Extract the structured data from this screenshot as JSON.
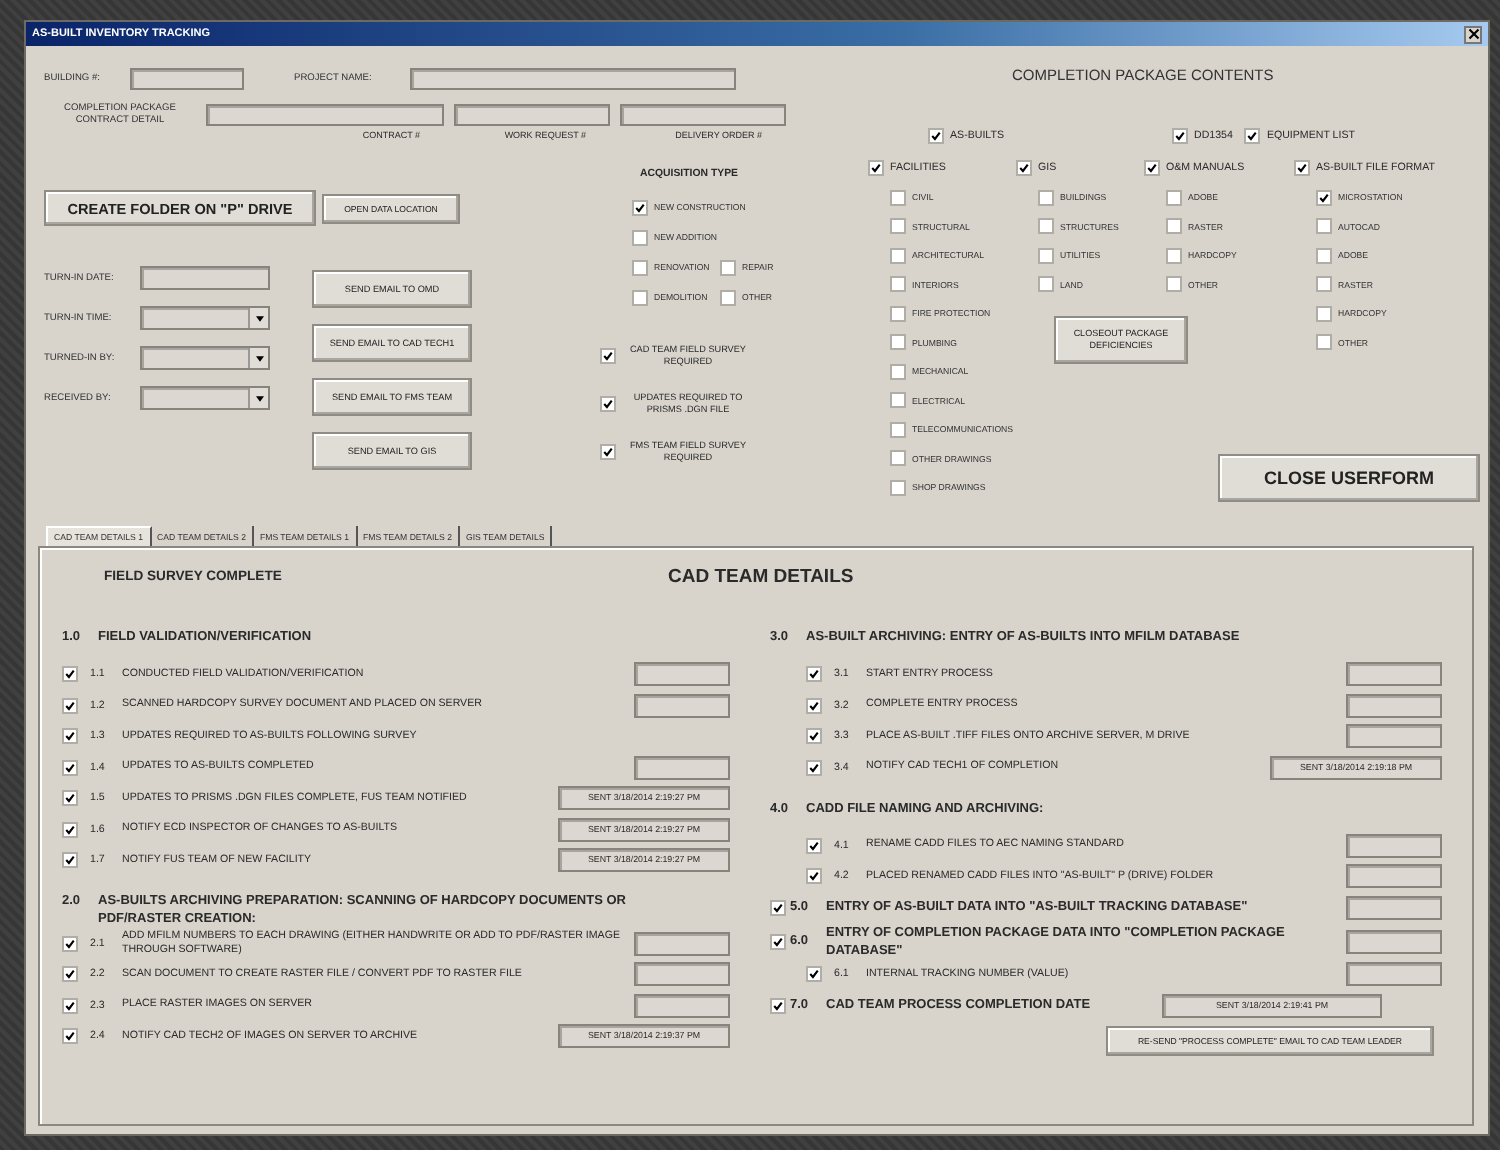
{
  "window": {
    "title": "AS-BUILT INVENTORY TRACKING"
  },
  "header": {
    "building_label": "BUILDING #:",
    "project_label": "PROJECT NAME:",
    "contract_detail_label": "COMPLETION PACKAGE CONTRACT DETAIL",
    "contract_fields": [
      "CONTRACT #",
      "WORK REQUEST #",
      "DELIVERY ORDER #"
    ]
  },
  "folder_buttons": [
    "CREATE FOLDER ON \"P\" DRIVE",
    "OPEN DATA LOCATION"
  ],
  "turn_in": [
    {
      "label": "TURN-IN DATE:",
      "kind": "text"
    },
    {
      "label": "TURN-IN TIME:",
      "kind": "dropdown"
    },
    {
      "label": "TURNED-IN BY:",
      "kind": "dropdown"
    },
    {
      "label": "RECEIVED BY:",
      "kind": "dropdown"
    }
  ],
  "email_buttons": [
    "SEND EMAIL TO OMD",
    "SEND EMAIL TO CAD TECH1",
    "SEND EMAIL TO FMS TEAM",
    "SEND EMAIL TO GIS"
  ],
  "acquisition": {
    "title": "ACQUISITION TYPE",
    "options": [
      {
        "label": "NEW CONSTRUCTION",
        "checked": true
      },
      {
        "label": "NEW ADDITION",
        "checked": false
      },
      {
        "label": "RENOVATION",
        "checked": false
      },
      {
        "label": "REPAIR",
        "checked": false
      },
      {
        "label": "DEMOLITION",
        "checked": false
      },
      {
        "label": "OTHER",
        "checked": false
      }
    ]
  },
  "flags": [
    {
      "label": "CAD TEAM FIELD SURVEY REQUIRED",
      "checked": true
    },
    {
      "label": "UPDATES REQUIRED TO PRISMS .DGN FILE",
      "checked": true
    },
    {
      "label": "FMS TEAM FIELD SURVEY REQUIRED",
      "checked": true
    }
  ],
  "contents": {
    "title": "COMPLETION PACKAGE CONTENTS",
    "top_options": [
      {
        "label": "AS-BUILTS",
        "checked": true
      },
      {
        "label": "DD1354",
        "checked": true
      },
      {
        "label": "EQUIPMENT LIST",
        "checked": true
      }
    ],
    "groups": [
      {
        "label": "FACILITIES",
        "checked": true,
        "items": [
          {
            "label": "CIVIL",
            "checked": false
          },
          {
            "label": "STRUCTURAL",
            "checked": false
          },
          {
            "label": "ARCHITECTURAL",
            "checked": false
          },
          {
            "label": "INTERIORS",
            "checked": false
          },
          {
            "label": "FIRE PROTECTION",
            "checked": false
          },
          {
            "label": "PLUMBING",
            "checked": false
          },
          {
            "label": "MECHANICAL",
            "checked": false
          },
          {
            "label": "ELECTRICAL",
            "checked": false
          },
          {
            "label": "TELECOMMUNICATIONS",
            "checked": false
          },
          {
            "label": "OTHER DRAWINGS",
            "checked": false
          },
          {
            "label": "SHOP DRAWINGS",
            "checked": false
          }
        ]
      },
      {
        "label": "GIS",
        "checked": true,
        "items": [
          {
            "label": "BUILDINGS",
            "checked": false
          },
          {
            "label": "STRUCTURES",
            "checked": false
          },
          {
            "label": "UTILITIES",
            "checked": false
          },
          {
            "label": "LAND",
            "checked": false
          }
        ]
      },
      {
        "label": "O&M MANUALS",
        "checked": true,
        "items": [
          {
            "label": "ADOBE",
            "checked": false
          },
          {
            "label": "RASTER",
            "checked": false
          },
          {
            "label": "HARDCOPY",
            "checked": false
          },
          {
            "label": "OTHER",
            "checked": false
          }
        ]
      },
      {
        "label": "AS-BUILT FILE FORMAT",
        "checked": true,
        "items": [
          {
            "label": "MICROSTATION",
            "checked": true
          },
          {
            "label": "AUTOCAD",
            "checked": false
          },
          {
            "label": "ADOBE",
            "checked": false
          },
          {
            "label": "RASTER",
            "checked": false
          },
          {
            "label": "HARDCOPY",
            "checked": false
          },
          {
            "label": "OTHER",
            "checked": false
          }
        ]
      }
    ],
    "closeout_button": "CLOSEOUT PACKAGE DEFICIENCIES",
    "close_button": "CLOSE USERFORM"
  },
  "tabs": [
    {
      "label": "CAD TEAM DETAILS 1",
      "selected": true
    },
    {
      "label": "CAD TEAM DETAILS 2",
      "selected": false
    },
    {
      "label": "FMS TEAM DETAILS 1",
      "selected": false
    },
    {
      "label": "FMS TEAM DETAILS 2",
      "selected": false
    },
    {
      "label": "GIS TEAM DETAILS",
      "selected": false
    }
  ],
  "details": {
    "left_title": "FIELD SURVEY COMPLETE",
    "title": "CAD TEAM DETAILS",
    "columns": [
      [
        {
          "kind": "section",
          "number": "1.0",
          "label": "FIELD VALIDATION/VERIFICATION"
        },
        {
          "kind": "item",
          "number": "1.1",
          "label": "CONDUCTED FIELD VALIDATION/VERIFICATION",
          "checked": true,
          "field": true
        },
        {
          "kind": "item",
          "number": "1.2",
          "label": "SCANNED HARDCOPY SURVEY DOCUMENT AND PLACED ON SERVER",
          "checked": true,
          "field": true
        },
        {
          "kind": "item",
          "number": "1.3",
          "label": "UPDATES REQUIRED TO AS-BUILTS FOLLOWING SURVEY",
          "checked": true,
          "field": false
        },
        {
          "kind": "item",
          "number": "1.4",
          "label": "UPDATES TO AS-BUILTS COMPLETED",
          "checked": true,
          "field": true
        },
        {
          "kind": "item",
          "number": "1.5",
          "label": "UPDATES TO PRISMS .DGN FILES COMPLETE, FUS TEAM NOTIFIED",
          "checked": true,
          "field": true,
          "value": "SENT 3/18/2014 2:19:27 PM"
        },
        {
          "kind": "item",
          "number": "1.6",
          "label": "NOTIFY ECD INSPECTOR OF CHANGES TO AS-BUILTS",
          "checked": true,
          "field": true,
          "value": "SENT 3/18/2014 2:19:27 PM"
        },
        {
          "kind": "item",
          "number": "1.7",
          "label": "NOTIFY FUS TEAM OF NEW FACILITY",
          "checked": true,
          "field": true,
          "value": "SENT 3/18/2014 2:19:27 PM"
        },
        {
          "kind": "section",
          "number": "2.0",
          "label": "AS-BUILTS ARCHIVING PREPARATION:  SCANNING OF HARDCOPY DOCUMENTS OR PDF/RASTER CREATION:"
        },
        {
          "kind": "item",
          "number": "2.1",
          "label": "ADD MFILM NUMBERS TO EACH DRAWING (EITHER HANDWRITE OR ADD TO PDF/RASTER IMAGE THROUGH SOFTWARE)",
          "checked": true,
          "field": true
        },
        {
          "kind": "item",
          "number": "2.2",
          "label": "SCAN DOCUMENT TO CREATE RASTER FILE / CONVERT PDF TO RASTER FILE",
          "checked": true,
          "field": true
        },
        {
          "kind": "item",
          "number": "2.3",
          "label": "PLACE RASTER IMAGES ON SERVER",
          "checked": true,
          "field": true
        },
        {
          "kind": "item",
          "number": "2.4",
          "label": "NOTIFY CAD TECH2 OF IMAGES ON SERVER TO ARCHIVE",
          "checked": true,
          "field": true,
          "value": "SENT 3/18/2014 2:19:37 PM"
        }
      ],
      [
        {
          "kind": "section",
          "number": "3.0",
          "label": "AS-BUILT ARCHIVING:  ENTRY OF AS-BUILTS INTO MFILM DATABASE"
        },
        {
          "kind": "item",
          "number": "3.1",
          "label": "START ENTRY PROCESS",
          "checked": true,
          "field": true
        },
        {
          "kind": "item",
          "number": "3.2",
          "label": "COMPLETE ENTRY PROCESS",
          "checked": true,
          "field": true
        },
        {
          "kind": "item",
          "number": "3.3",
          "label": "PLACE AS-BUILT .TIFF FILES ONTO ARCHIVE SERVER, M DRIVE",
          "checked": true,
          "field": true
        },
        {
          "kind": "item",
          "number": "3.4",
          "label": "NOTIFY CAD TECH1 OF COMPLETION",
          "checked": true,
          "field": true,
          "value": "SENT 3/18/2014 2:19:18 PM"
        },
        {
          "kind": "section",
          "number": "4.0",
          "label": "CADD FILE NAMING AND ARCHIVING:"
        },
        {
          "kind": "item",
          "number": "4.1",
          "label": "RENAME CADD FILES TO AEC NAMING STANDARD",
          "checked": true,
          "field": true
        },
        {
          "kind": "item",
          "number": "4.2",
          "label": "PLACED RENAMED CADD FILES INTO \"AS-BUILT\" P (DRIVE) FOLDER",
          "checked": true,
          "field": true
        },
        {
          "kind": "major",
          "number": "5.0",
          "label": "ENTRY OF AS-BUILT DATA INTO \"AS-BUILT TRACKING DATABASE\"",
          "checked": true,
          "field": true
        },
        {
          "kind": "major",
          "number": "6.0",
          "label": "ENTRY OF COMPLETION PACKAGE DATA INTO \"COMPLETION PACKAGE DATABASE\"",
          "checked": true,
          "field": true
        },
        {
          "kind": "item",
          "number": "6.1",
          "label": "INTERNAL TRACKING NUMBER (VALUE)",
          "checked": true,
          "field": true
        },
        {
          "kind": "major",
          "number": "7.0",
          "label": "CAD TEAM PROCESS COMPLETION DATE",
          "checked": true,
          "field": true,
          "value": "SENT 3/18/2014 2:19:41 PM"
        }
      ]
    ],
    "resend_button": "RE-SEND \"PROCESS COMPLETE\" EMAIL TO CAD TEAM LEADER"
  }
}
